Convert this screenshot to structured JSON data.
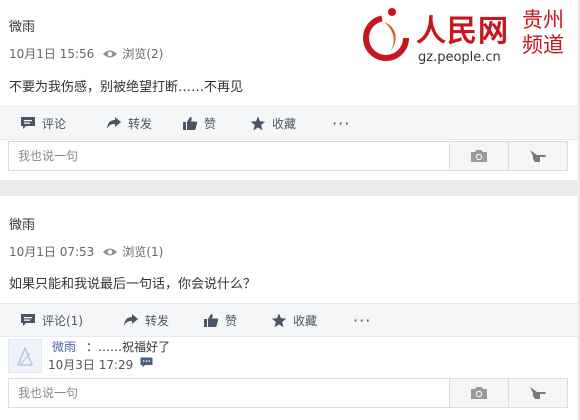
{
  "logo": {
    "brand": "人民网",
    "url": "gz.people.cn",
    "region_line1": "贵州",
    "region_line2": "频道"
  },
  "posts": [
    {
      "author": "微雨",
      "date": "10月1日 15:56",
      "views": "浏览(2)",
      "content": "不要为我伤感，别被绝望打断……不再见",
      "actions": {
        "comment": "评论",
        "forward": "转发",
        "like": "赞",
        "collect": "收藏",
        "more": "···"
      },
      "reply_placeholder": "我也说一句",
      "comments": []
    },
    {
      "author": "微雨",
      "date": "10月1日 07:53",
      "views": "浏览(1)",
      "content": "如果只能和我说最后一句话，你会说什么？",
      "actions": {
        "comment": "评论(1)",
        "forward": "转发",
        "like": "赞",
        "collect": "收藏",
        "more": "···"
      },
      "reply_placeholder": "我也说一句",
      "comments": [
        {
          "author": "微雨",
          "text": "：……祝福好了",
          "time": "10月3日 17:29"
        }
      ]
    }
  ],
  "colors": {
    "brand_red": "#c8161d",
    "action_text": "#4a5566",
    "link_blue": "#4a66a8"
  }
}
